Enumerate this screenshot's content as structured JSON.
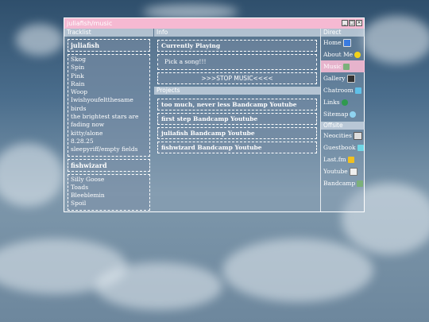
{
  "window": {
    "title": "juliafish/music"
  },
  "tracklist": {
    "header": "Tracklist",
    "sections": [
      {
        "artist": "juliafish",
        "tracks": [
          "Skog",
          "Spin",
          "Pink",
          "Rain",
          "Woop",
          "Iwishyoufeltthesame",
          "birds",
          "the brightest stars are",
          "fading now",
          "kitty/alone",
          "8.28.25",
          "sleepyriff/empty fields"
        ]
      },
      {
        "artist": "fishwizard",
        "tracks": [
          "Silly Goose",
          "Toads",
          "Bleeblemin",
          "Spoil"
        ]
      }
    ]
  },
  "info": {
    "header": "Info",
    "now_playing_label": "Currently Playing",
    "now_playing_value": "Pick a song!!!",
    "stop_button": ">>>STOP MUSIC<<<<",
    "projects_header": "Projects",
    "projects": [
      "too much, never less Bandcamp Youtube",
      "first step Bandcamp Youtube",
      "juliafish Bandcamp Youtube",
      "fishwizard Bandcamp Youtube"
    ]
  },
  "directory": {
    "header": "Direct",
    "items": [
      {
        "label": "Home",
        "icon": "monitor-icon"
      },
      {
        "label": "About Me",
        "icon": "question-icon"
      },
      {
        "label": "Music",
        "icon": "note-icon",
        "active": true
      },
      {
        "label": "Gallery",
        "icon": "camera-icon"
      },
      {
        "label": "Chatroom",
        "icon": "chat-icon"
      },
      {
        "label": "Links",
        "icon": "globe-icon"
      },
      {
        "label": "Sitemap",
        "icon": "magnifier-icon"
      }
    ],
    "offsite_header": "Offsite",
    "offsite": [
      {
        "label": "Neocities",
        "icon": "window-icon"
      },
      {
        "label": "Guestbook",
        "icon": "book-icon"
      },
      {
        "label": "Last.fm",
        "icon": "play-icon"
      },
      {
        "label": "Youtube",
        "icon": "tv-icon"
      },
      {
        "label": "Bandcamp",
        "icon": "note-icon"
      }
    ]
  },
  "colors": {
    "titlebar": "#f5b9d2",
    "active_nav": "#f5b9d2"
  }
}
